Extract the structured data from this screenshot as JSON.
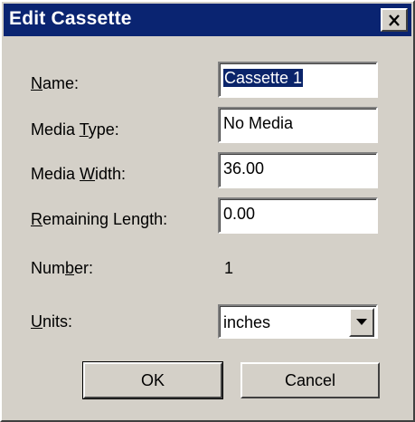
{
  "window": {
    "title": "Edit Cassette"
  },
  "fields": {
    "name": {
      "label_prefix": "",
      "label_accel": "N",
      "label_suffix": "ame:",
      "value": "Cassette 1"
    },
    "media_type": {
      "label_prefix": "Media ",
      "label_accel": "T",
      "label_suffix": "ype:",
      "value": "No Media"
    },
    "media_width": {
      "label_prefix": "Media ",
      "label_accel": "W",
      "label_suffix": "idth:",
      "value": "36.00"
    },
    "remaining_length": {
      "label_prefix": "",
      "label_accel": "R",
      "label_suffix": "emaining Length:",
      "value": "0.00"
    },
    "number": {
      "label_prefix": "Num",
      "label_accel": "b",
      "label_suffix": "er:",
      "value": "1"
    },
    "units": {
      "label_prefix": "",
      "label_accel": "U",
      "label_suffix": "nits:",
      "value": "inches"
    }
  },
  "buttons": {
    "ok": "OK",
    "cancel": "Cancel"
  }
}
